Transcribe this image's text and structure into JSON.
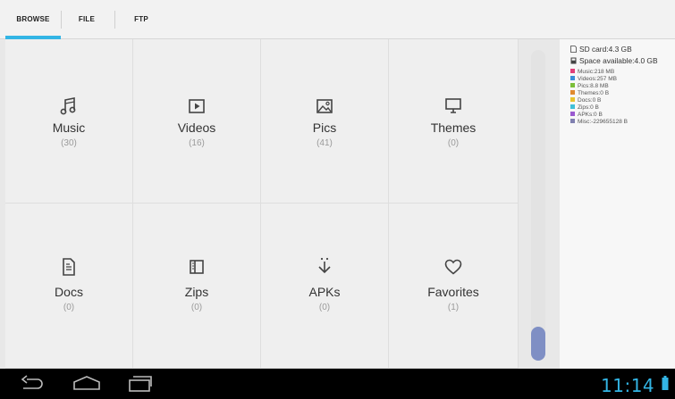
{
  "tabs": [
    {
      "label": "BROWSE",
      "active": true
    },
    {
      "label": "FILE",
      "active": false
    },
    {
      "label": "FTP",
      "active": false
    }
  ],
  "categories": [
    {
      "label": "Music",
      "count": "(30)",
      "icon": "music-icon"
    },
    {
      "label": "Videos",
      "count": "(16)",
      "icon": "video-icon"
    },
    {
      "label": "Pics",
      "count": "(41)",
      "icon": "picture-icon"
    },
    {
      "label": "Themes",
      "count": "(0)",
      "icon": "monitor-icon"
    },
    {
      "label": "Docs",
      "count": "(0)",
      "icon": "document-icon"
    },
    {
      "label": "Zips",
      "count": "(0)",
      "icon": "archive-icon"
    },
    {
      "label": "APKs",
      "count": "(0)",
      "icon": "download-arrow-icon"
    },
    {
      "label": "Favorites",
      "count": "(1)",
      "icon": "heart-icon"
    }
  ],
  "storage": {
    "sd_card": "SD card:4.3 GB",
    "space_available": "Space available:4.0 GB",
    "breakdown": [
      {
        "label": "Music:218 MB",
        "color": "#e0407a"
      },
      {
        "label": "Videos:257 MB",
        "color": "#3a8fd8"
      },
      {
        "label": "Pics:8.8 MB",
        "color": "#7cbf3a"
      },
      {
        "label": "Themes:0 B",
        "color": "#e08a30"
      },
      {
        "label": "Docs:0 B",
        "color": "#e8c430"
      },
      {
        "label": "Zips:0 B",
        "color": "#40c0d8"
      },
      {
        "label": "APKs:0 B",
        "color": "#9a5ad0"
      },
      {
        "label": "Misc:-229655128 B",
        "color": "#8080b0"
      }
    ]
  },
  "status_bar": {
    "time": "11:14"
  },
  "colors": {
    "accent": "#33b5e5",
    "scroll_thumb": "#7f8fc4"
  }
}
